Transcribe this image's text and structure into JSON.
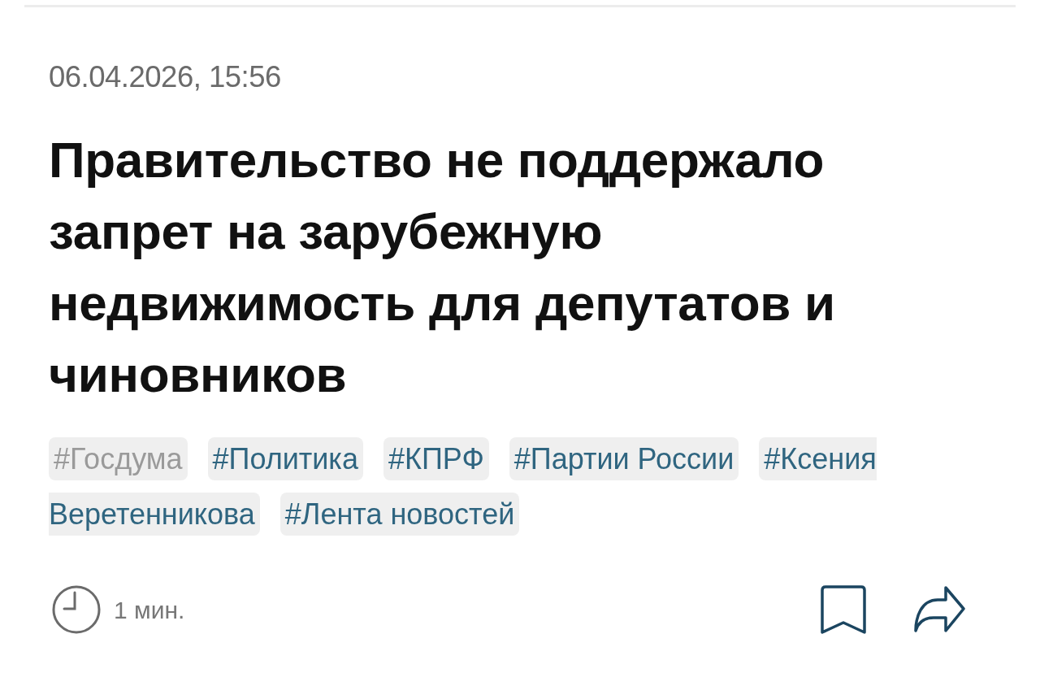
{
  "date": "06.04.2026, 15:56",
  "title": "Правительство не поддержало запрет на зарубежную недвижимость для депутатов и чиновников",
  "tags": [
    {
      "label": "#Госдума",
      "visited": true
    },
    {
      "label": "#Политика",
      "visited": false
    },
    {
      "label": "#КПРФ",
      "visited": false
    },
    {
      "label": "#Партии России",
      "visited": false
    },
    {
      "label": "#Ксения Веретенникова",
      "visited": false
    },
    {
      "label": "#Лента новостей",
      "visited": false
    }
  ],
  "footer": {
    "read_time": "1 мин."
  }
}
